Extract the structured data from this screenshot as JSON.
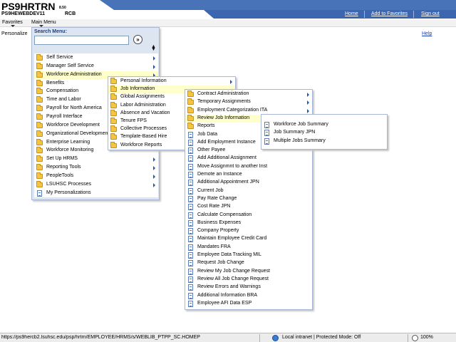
{
  "header": {
    "system_name": "PS9HRTRN",
    "version": "8.50",
    "database": "PS9HEWEBDEV11",
    "user": "RCB",
    "links": [
      "Home",
      "Add to Favorites",
      "Sign out"
    ]
  },
  "menubar": {
    "favorites": "Favorites",
    "main_menu": "Main Menu"
  },
  "page": {
    "personalize": "Personalize",
    "help": "Help"
  },
  "search_menu": {
    "label": "Search Menu:",
    "value": "",
    "go_symbol": "»"
  },
  "main_menu_items": [
    {
      "label": "Self Service",
      "arrow": true
    },
    {
      "label": "Manager Self Service",
      "arrow": true
    },
    {
      "label": "Workforce Administration",
      "arrow": true,
      "highlight": true
    },
    {
      "label": "Benefits",
      "arrow": false
    },
    {
      "label": "Compensation",
      "arrow": false
    },
    {
      "label": "Time and Labor",
      "arrow": false
    },
    {
      "label": "Payroll for North America",
      "arrow": false
    },
    {
      "label": "Payroll Interface",
      "arrow": false
    },
    {
      "label": "Workforce Development",
      "arrow": false
    },
    {
      "label": "Organizational Development",
      "arrow": false
    },
    {
      "label": "Enterprise Learning",
      "arrow": false
    },
    {
      "label": "Workforce Monitoring",
      "arrow": false
    },
    {
      "label": "Set Up HRMS",
      "arrow": true
    },
    {
      "label": "Reporting Tools",
      "arrow": true
    },
    {
      "label": "PeopleTools",
      "arrow": true
    },
    {
      "label": "LSUHSC Processes",
      "arrow": true
    },
    {
      "label": "My Personalizations",
      "arrow": false,
      "doc": true
    }
  ],
  "workforce_admin_items": [
    {
      "label": "Personal Information",
      "arrow": true
    },
    {
      "label": "Job Information",
      "arrow": false,
      "highlight": true
    },
    {
      "label": "Global Assignments",
      "arrow": false
    },
    {
      "label": "Labor Administration",
      "arrow": false
    },
    {
      "label": "Absence and Vacation",
      "arrow": false
    },
    {
      "label": "Tenure FPS",
      "arrow": false
    },
    {
      "label": "Collective Processes",
      "arrow": false
    },
    {
      "label": "Template-Based Hire",
      "arrow": false
    },
    {
      "label": "Workforce Reports",
      "arrow": false
    }
  ],
  "job_info_items": [
    {
      "label": "Contract Administration",
      "arrow": true,
      "folder": true
    },
    {
      "label": "Temporary Assignments",
      "arrow": true,
      "folder": true
    },
    {
      "label": "Employment Categorization ITA",
      "arrow": true,
      "folder": true
    },
    {
      "label": "Review Job Information",
      "arrow": true,
      "folder": true,
      "highlight": true
    },
    {
      "label": "Reports",
      "arrow": false,
      "folder": true
    },
    {
      "label": "Job Data",
      "arrow": false
    },
    {
      "label": "Add Employment Instance",
      "arrow": false
    },
    {
      "label": "Other Payee",
      "arrow": false
    },
    {
      "label": "Add Additional Assignment",
      "arrow": false
    },
    {
      "label": "Move Assignmnt to another Inst",
      "arrow": false
    },
    {
      "label": "Demote an Instance",
      "arrow": false
    },
    {
      "label": "Additional Appointment JPN",
      "arrow": false
    },
    {
      "label": "Current Job",
      "arrow": false
    },
    {
      "label": "Pay Rate Change",
      "arrow": false
    },
    {
      "label": "Cost Rate JPN",
      "arrow": false
    },
    {
      "label": "Calculate Compensation",
      "arrow": false
    },
    {
      "label": "Business Expenses",
      "arrow": false
    },
    {
      "label": "Company Property",
      "arrow": false
    },
    {
      "label": "Maintain Employee Credit Card",
      "arrow": false
    },
    {
      "label": "Mandates FRA",
      "arrow": false
    },
    {
      "label": "Employee Data Tracking MIL",
      "arrow": false
    },
    {
      "label": "Request Job Change",
      "arrow": false
    },
    {
      "label": "Review My Job Change Request",
      "arrow": false
    },
    {
      "label": "Review All Job Change Request",
      "arrow": false
    },
    {
      "label": "Review Errors and Warnings",
      "arrow": false
    },
    {
      "label": "Additional Information BRA",
      "arrow": false
    },
    {
      "label": "Employee AFI Data ESP",
      "arrow": false
    }
  ],
  "review_job_items": [
    {
      "label": "Workforce Job Summary"
    },
    {
      "label": "Job Summary JPN"
    },
    {
      "label": "Multiple Jobs Summary"
    }
  ],
  "statusbar": {
    "url": "https://ps9hercb2.lsuhsc.edu/psp/hrtrn/EMPLOYEE/HRMS/s/WEBLIB_PTPP_SC.HOMEP",
    "zone": "Local intranet | Protected Mode: Off",
    "zoom": "100%"
  }
}
